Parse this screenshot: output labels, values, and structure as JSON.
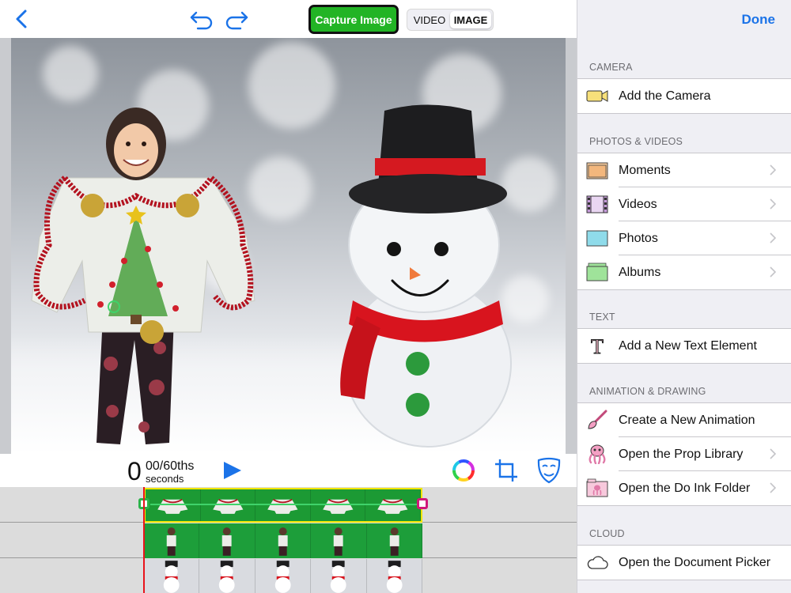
{
  "toolbar": {
    "capture_label": "Capture Image",
    "modes": [
      {
        "label": "VIDEO",
        "active": false
      },
      {
        "label": "IMAGE",
        "active": true
      }
    ]
  },
  "playback": {
    "seconds": "0",
    "fraction": "00/60ths",
    "unit": "seconds"
  },
  "panel": {
    "done_label": "Done",
    "sections": [
      {
        "header": "CAMERA",
        "items": [
          {
            "label": "Add the Camera",
            "icon": "camera-icon",
            "chevron": false
          }
        ]
      },
      {
        "header": "PHOTOS & VIDEOS",
        "items": [
          {
            "label": "Moments",
            "icon": "moments-folder-icon",
            "chevron": true
          },
          {
            "label": "Videos",
            "icon": "film-icon",
            "chevron": true
          },
          {
            "label": "Photos",
            "icon": "photos-folder-icon",
            "chevron": true
          },
          {
            "label": "Albums",
            "icon": "albums-folder-icon",
            "chevron": true
          }
        ]
      },
      {
        "header": "TEXT",
        "items": [
          {
            "label": "Add a New Text Element",
            "icon": "text-t-icon",
            "chevron": false
          }
        ]
      },
      {
        "header": "ANIMATION & DRAWING",
        "items": [
          {
            "label": "Create a New Animation",
            "icon": "paintbrush-icon",
            "chevron": false
          },
          {
            "label": "Open the Prop Library",
            "icon": "octopus-icon",
            "chevron": true
          },
          {
            "label": "Open the Do Ink Folder",
            "icon": "doink-folder-icon",
            "chevron": true
          }
        ]
      },
      {
        "header": "CLOUD",
        "items": [
          {
            "label": "Open the Document Picker",
            "icon": "cloud-icon",
            "chevron": false
          }
        ]
      }
    ]
  },
  "colors": {
    "accent": "#1b73e8",
    "capture_green": "#22b425",
    "playhead": "#e8141c",
    "clip_highlight": "#f2e600"
  }
}
